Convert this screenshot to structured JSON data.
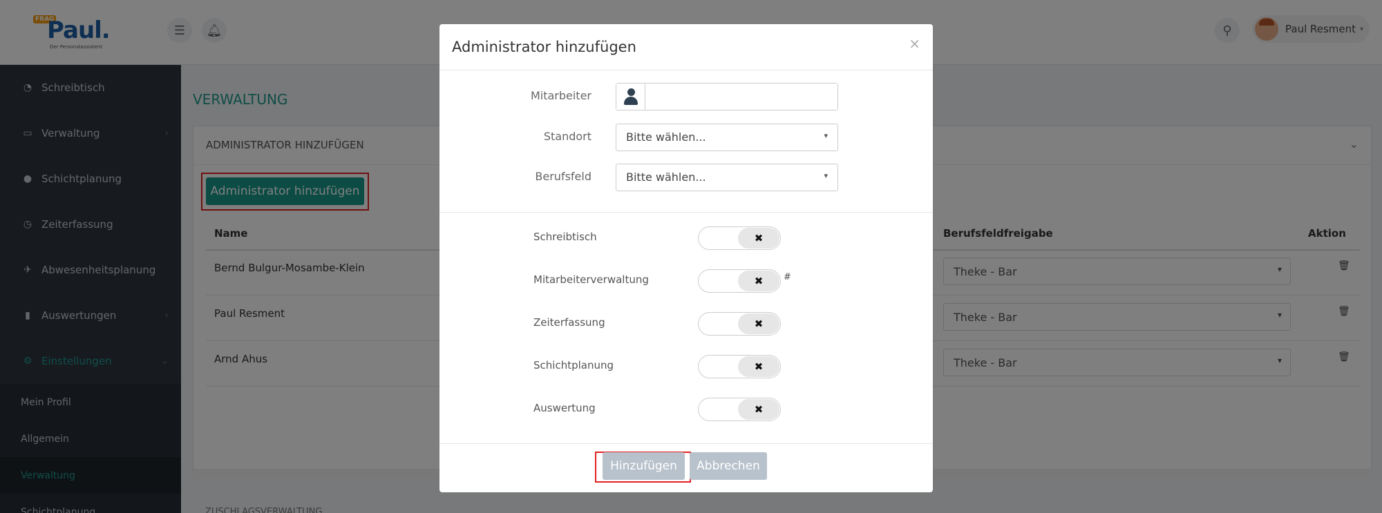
{
  "app": {
    "logo_tag": "FRAG",
    "logo_text": "Paul.",
    "logo_sub": "Der Personalassistent"
  },
  "header": {
    "menu_icon": "hamburger-icon",
    "bell_icon": "bell-icon",
    "search_icon": "search-icon",
    "user_name": "Paul Resment"
  },
  "sidebar": {
    "items": [
      {
        "label": "Schreibtisch",
        "icon": "dashboard-icon"
      },
      {
        "label": "Verwaltung",
        "icon": "laptop-icon"
      },
      {
        "label": "Schichtplanung",
        "icon": "users-icon"
      },
      {
        "label": "Zeiterfassung",
        "icon": "clock-icon"
      },
      {
        "label": "Abwesenheitsplanung",
        "icon": "plane-icon"
      },
      {
        "label": "Auswertungen",
        "icon": "bar-chart-icon"
      },
      {
        "label": "Einstellungen",
        "icon": "gears-icon"
      }
    ],
    "sub_items": [
      {
        "label": "Mein Profil"
      },
      {
        "label": "Allgemein"
      },
      {
        "label": "Verwaltung"
      },
      {
        "label": "Schichtplanung"
      }
    ]
  },
  "main": {
    "title": "VERWALTUNG",
    "panel_title": "ADMINISTRATOR HINZUFÜGEN",
    "add_button": "Administrator hinzufügen",
    "columns": {
      "name": "Name",
      "berufsfeldfreigabe": "Berufsfeldfreigabe",
      "aktion": "Aktion"
    },
    "rows": [
      {
        "name": "Bernd Bulgur-Mosambe-Klein",
        "berufsfeld": "Theke - Bar"
      },
      {
        "name": "Paul Resment",
        "berufsfeld": "Theke - Bar"
      },
      {
        "name": "Arnd Ahus",
        "berufsfeld": "Theke - Bar"
      }
    ],
    "lower_title": "ZUSCHLAGSVERWALTUNG"
  },
  "modal": {
    "title": "Administrator hinzufügen",
    "close": "×",
    "mitarbeiter_label": "Mitarbeiter",
    "mitarbeiter_value": "",
    "standort_label": "Standort",
    "standort_value": "Bitte wählen...",
    "berufsfeld_label": "Berufsfeld",
    "berufsfeld_value": "Bitte wählen...",
    "permissions": [
      {
        "label": "Schreibtisch",
        "value": "off"
      },
      {
        "label": "Mitarbeiterverwaltung",
        "value": "off"
      },
      {
        "label": "Zeiterfassung",
        "value": "off"
      },
      {
        "label": "Schichtplanung",
        "value": "off"
      },
      {
        "label": "Auswertung",
        "value": "off"
      }
    ],
    "hash_note": "#",
    "submit": "Hinzufügen",
    "cancel": "Abbrechen"
  },
  "colors": {
    "accent": "#18988b",
    "sidebar_bg": "#2f3640",
    "highlight_border": "#e02020"
  }
}
